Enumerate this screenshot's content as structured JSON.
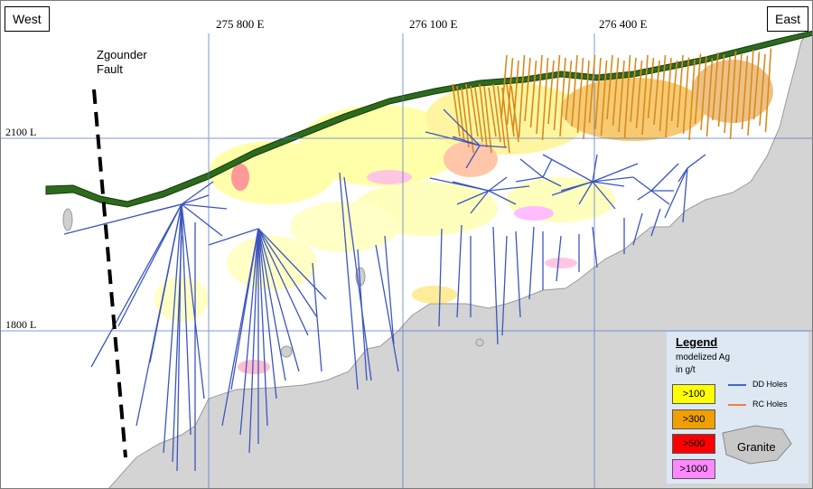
{
  "directions": {
    "west": "West",
    "east": "East"
  },
  "eastings": [
    "275 800 E",
    "276 100 E",
    "276 400 E"
  ],
  "levels": [
    "2100 L",
    "1800 L"
  ],
  "fault": {
    "line1": "Zgounder",
    "line2": "Fault"
  },
  "legend": {
    "title": "Legend",
    "subtitle_line1": "modelized Ag",
    "subtitle_line2": "in g/t",
    "grades": [
      {
        "label": ">100",
        "color": "#ffff00"
      },
      {
        "label": ">300",
        "color": "#f0a000"
      },
      {
        "label": ">500",
        "color": "#ff0000"
      },
      {
        "label": ">1000",
        "color": "#ff88ff"
      }
    ],
    "holes": [
      {
        "label": "DD Holes",
        "color": "#4466cc"
      },
      {
        "label": "RC Holes",
        "color": "#f08040"
      }
    ],
    "granite_label": "Granite",
    "granite_color": "#c8c8c8"
  }
}
